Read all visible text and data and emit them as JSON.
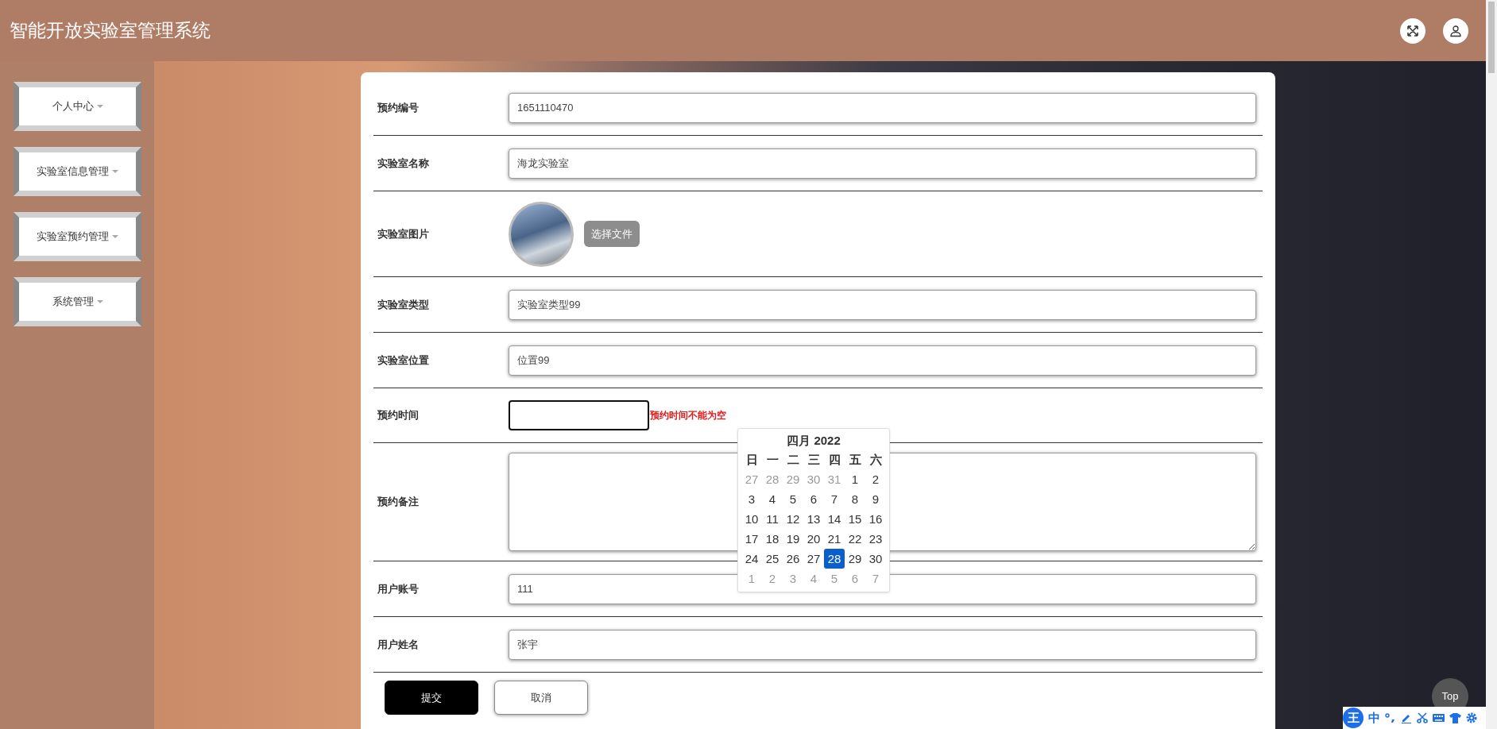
{
  "header": {
    "title": "智能开放实验室管理系统"
  },
  "sidebar": {
    "items": [
      {
        "label": "个人中心"
      },
      {
        "label": "实验室信息管理"
      },
      {
        "label": "实验室预约管理"
      },
      {
        "label": "系统管理"
      }
    ]
  },
  "form": {
    "fields": [
      {
        "kind": "text",
        "label": "预约编号",
        "value": "1651110470"
      },
      {
        "kind": "text",
        "label": "实验室名称",
        "value": "海龙实验室"
      },
      {
        "kind": "image",
        "label": "实验室图片",
        "button": "选择文件"
      },
      {
        "kind": "text",
        "label": "实验室类型",
        "value": "实验室类型99"
      },
      {
        "kind": "text",
        "label": "实验室位置",
        "value": "位置99"
      },
      {
        "kind": "date",
        "label": "预约时间",
        "error": "预约时间不能为空"
      },
      {
        "kind": "textarea",
        "label": "预约备注"
      },
      {
        "kind": "text",
        "label": "用户账号",
        "value": "111"
      },
      {
        "kind": "text",
        "label": "用户姓名",
        "value": "张宇"
      }
    ],
    "buttons": [
      {
        "kind": "primary",
        "label": "提交"
      },
      {
        "kind": "secondary",
        "label": "取消"
      }
    ]
  },
  "calendar": {
    "title": "四月 2022",
    "weekdays": [
      "日",
      "一",
      "二",
      "三",
      "四",
      "五",
      "六"
    ],
    "days": [
      {
        "label": "27",
        "muted": true,
        "selected": false
      },
      {
        "label": "28",
        "muted": true,
        "selected": false
      },
      {
        "label": "29",
        "muted": true,
        "selected": false
      },
      {
        "label": "30",
        "muted": true,
        "selected": false
      },
      {
        "label": "31",
        "muted": true,
        "selected": false
      },
      {
        "label": "1",
        "muted": false,
        "selected": false
      },
      {
        "label": "2",
        "muted": false,
        "selected": false
      },
      {
        "label": "3",
        "muted": false,
        "selected": false
      },
      {
        "label": "4",
        "muted": false,
        "selected": false
      },
      {
        "label": "5",
        "muted": false,
        "selected": false
      },
      {
        "label": "6",
        "muted": false,
        "selected": false
      },
      {
        "label": "7",
        "muted": false,
        "selected": false
      },
      {
        "label": "8",
        "muted": false,
        "selected": false
      },
      {
        "label": "9",
        "muted": false,
        "selected": false
      },
      {
        "label": "10",
        "muted": false,
        "selected": false
      },
      {
        "label": "11",
        "muted": false,
        "selected": false
      },
      {
        "label": "12",
        "muted": false,
        "selected": false
      },
      {
        "label": "13",
        "muted": false,
        "selected": false
      },
      {
        "label": "14",
        "muted": false,
        "selected": false
      },
      {
        "label": "15",
        "muted": false,
        "selected": false
      },
      {
        "label": "16",
        "muted": false,
        "selected": false
      },
      {
        "label": "17",
        "muted": false,
        "selected": false
      },
      {
        "label": "18",
        "muted": false,
        "selected": false
      },
      {
        "label": "19",
        "muted": false,
        "selected": false
      },
      {
        "label": "20",
        "muted": false,
        "selected": false
      },
      {
        "label": "21",
        "muted": false,
        "selected": false
      },
      {
        "label": "22",
        "muted": false,
        "selected": false
      },
      {
        "label": "23",
        "muted": false,
        "selected": false
      },
      {
        "label": "24",
        "muted": false,
        "selected": false
      },
      {
        "label": "25",
        "muted": false,
        "selected": false
      },
      {
        "label": "26",
        "muted": false,
        "selected": false
      },
      {
        "label": "27",
        "muted": false,
        "selected": false
      },
      {
        "label": "28",
        "muted": false,
        "selected": true
      },
      {
        "label": "29",
        "muted": false,
        "selected": false
      },
      {
        "label": "30",
        "muted": false,
        "selected": false
      },
      {
        "label": "1",
        "muted": true,
        "selected": false
      },
      {
        "label": "2",
        "muted": true,
        "selected": false
      },
      {
        "label": "3",
        "muted": true,
        "selected": false
      },
      {
        "label": "4",
        "muted": true,
        "selected": false
      },
      {
        "label": "5",
        "muted": true,
        "selected": false
      },
      {
        "label": "6",
        "muted": true,
        "selected": false
      },
      {
        "label": "7",
        "muted": true,
        "selected": false
      }
    ]
  },
  "top_button": {
    "label": "Top"
  },
  "ime_toolbar": {
    "logo": "王",
    "mode": "中"
  }
}
